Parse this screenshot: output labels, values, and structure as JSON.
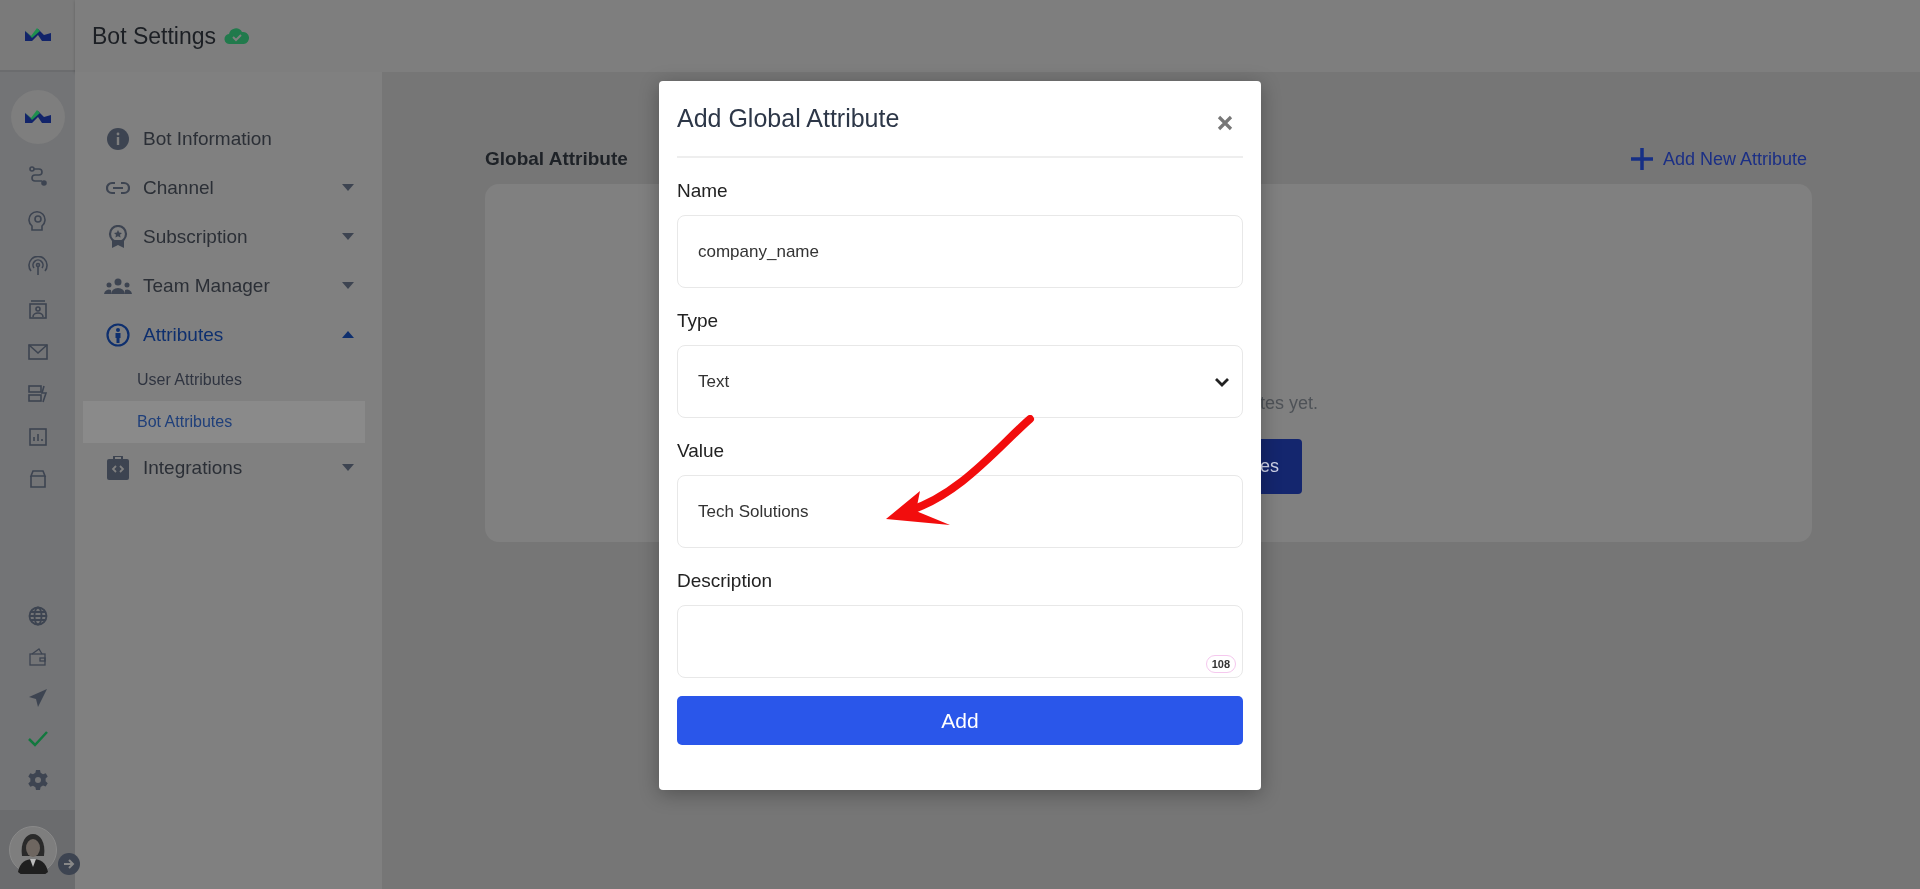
{
  "header": {
    "title": "Bot Settings"
  },
  "sidebar": {
    "items": [
      {
        "kind": "link",
        "label": "Bot Information",
        "selected": false
      },
      {
        "kind": "group",
        "label": "Channel",
        "selected": false,
        "expanded": false
      },
      {
        "kind": "group",
        "label": "Subscription",
        "selected": false,
        "expanded": false
      },
      {
        "kind": "group",
        "label": "Team Manager",
        "selected": false,
        "expanded": false
      },
      {
        "kind": "group",
        "label": "Attributes",
        "selected": true,
        "expanded": true,
        "children": [
          {
            "label": "User Attributes",
            "selected": false
          },
          {
            "label": "Bot Attributes",
            "selected": true
          }
        ]
      },
      {
        "kind": "group",
        "label": "Integrations",
        "selected": false,
        "expanded": false
      }
    ]
  },
  "main": {
    "heading": "Global Attribute",
    "add_link": "Add New Attribute",
    "empty_text": "tes yet.",
    "empty_button": "es"
  },
  "modal": {
    "title": "Add Global Attribute",
    "fields": [
      {
        "kind": "text",
        "label": "Name",
        "value": "company_name"
      },
      {
        "kind": "select",
        "label": "Type",
        "value": "Text"
      },
      {
        "kind": "text",
        "label": "Value",
        "value": "Tech Solutions"
      },
      {
        "kind": "textarea",
        "label": "Description",
        "counter": "108"
      }
    ],
    "submit": "Add"
  }
}
